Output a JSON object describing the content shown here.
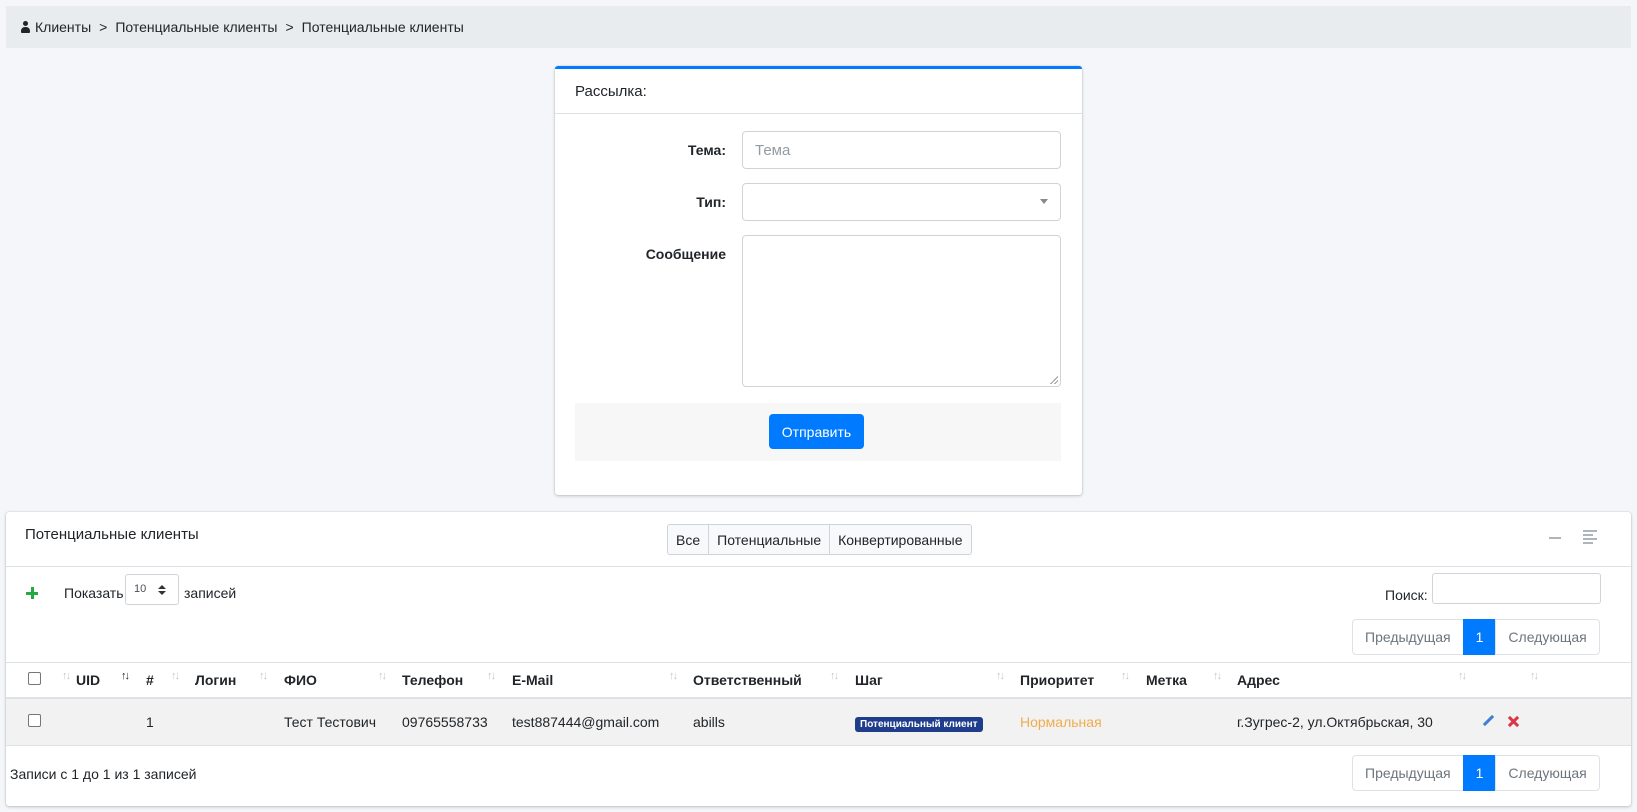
{
  "breadcrumb": {
    "items": [
      "Клиенты",
      "Потенциальные клиенты",
      "Потенциальные клиенты"
    ],
    "separator": ">"
  },
  "mailing": {
    "title": "Рассылка:",
    "subject_label": "Тема:",
    "subject_placeholder": "Тема",
    "type_label": "Тип:",
    "type_value": "",
    "message_label": "Сообщение",
    "message_value": "",
    "submit_label": "Отправить"
  },
  "clients": {
    "title": "Потенциальные клиенты",
    "filters": [
      "Все",
      "Потенциальные",
      "Конвертированные"
    ],
    "show_label": "Показать",
    "page_length": "10",
    "records_label": "записей",
    "search_label": "Поиск:",
    "search_value": "",
    "pager": {
      "prev": "Предыдущая",
      "current": "1",
      "next": "Следующая"
    },
    "columns": [
      "UID",
      "#",
      "Логин",
      "ФИО",
      "Телефон",
      "E-Mail",
      "Ответственный",
      "Шаг",
      "Приоритет",
      "Метка",
      "Адрес"
    ],
    "rows": [
      {
        "uid": "",
        "num": "1",
        "login": "",
        "fio": "Тест Тестович",
        "phone": "09765558733",
        "email": "test887444@gmail.com",
        "responsible": "abills",
        "step": "Потенциальный клиент",
        "priority": "Нормальная",
        "label": "",
        "address": "г.Зугрес-2, ул.Октябрьская, 30"
      }
    ],
    "info": "Записи с 1 до 1 из 1 записей"
  },
  "colors": {
    "primary": "#007bff",
    "step_badge": "#1f3d8b",
    "priority": "#f0ad4e",
    "add": "#28a745",
    "delete": "#dc3545"
  }
}
